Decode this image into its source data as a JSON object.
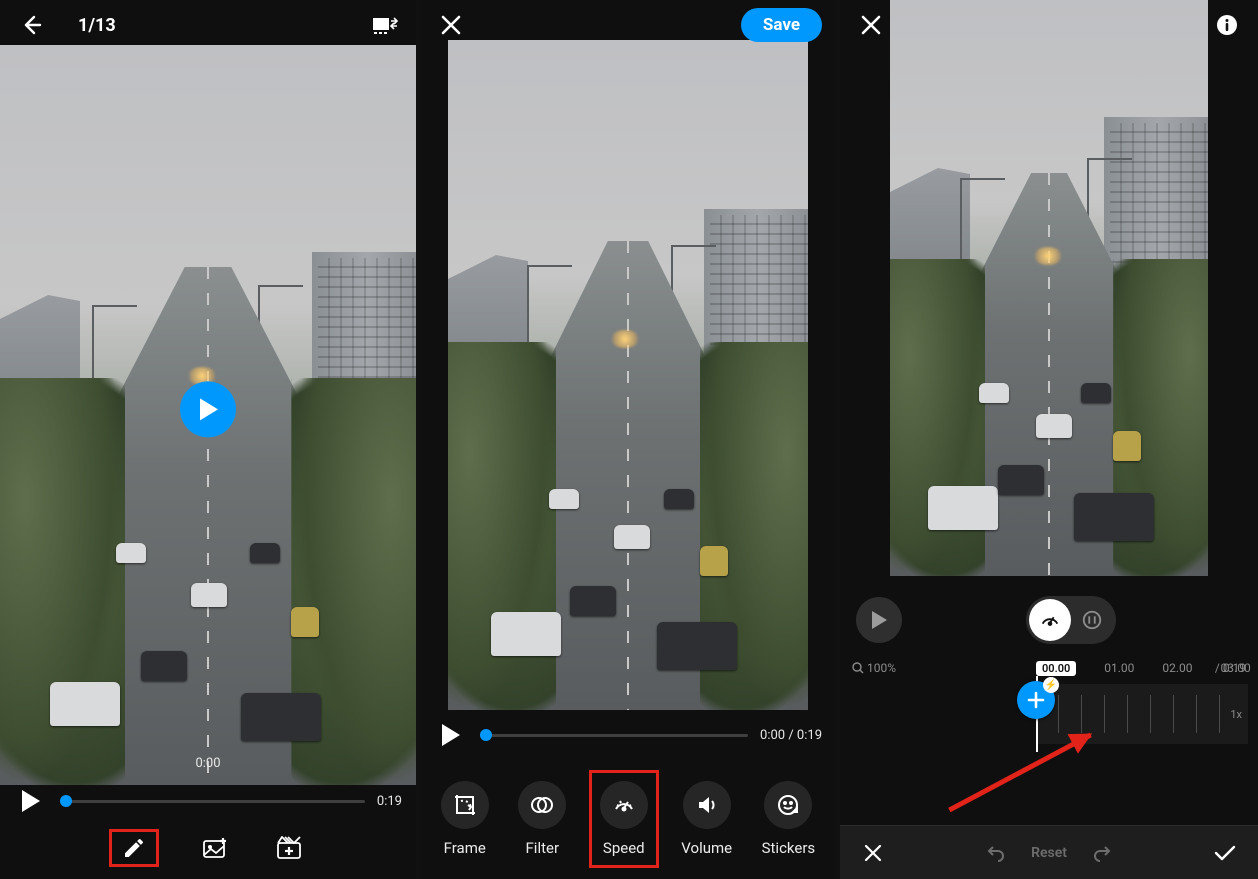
{
  "screen1": {
    "counter": "1/13",
    "time_current": "0:00",
    "time_total": "0:19"
  },
  "screen2": {
    "save_label": "Save",
    "time_display": "0:00 / 0:19",
    "tools": {
      "frame": "Frame",
      "filter": "Filter",
      "speed": "Speed",
      "volume": "Volume",
      "stickers": "Stickers"
    }
  },
  "screen3": {
    "zoom": "100%",
    "tl_current": "00.00",
    "tl_marks": {
      "m1": "01.00",
      "m2": "02.00",
      "m3": "03.00"
    },
    "tl_total": "/ 0:19",
    "speed_multiplier": "1x",
    "reset_label": "Reset"
  }
}
